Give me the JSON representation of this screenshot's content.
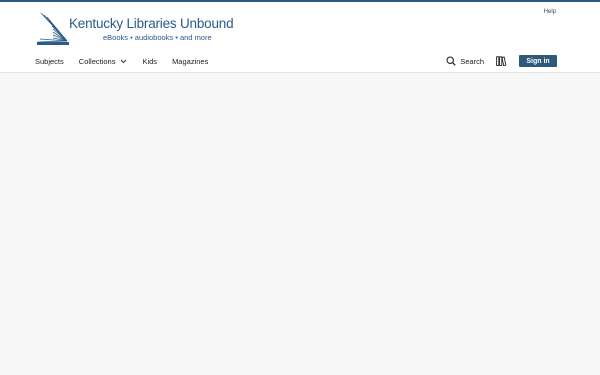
{
  "header": {
    "help_label": "Help",
    "logo": {
      "title": "Kentucky Libraries Unbound",
      "subtitle": "eBooks • audiobooks • and more"
    }
  },
  "nav": {
    "items": [
      {
        "label": "Subjects"
      },
      {
        "label": "Collections"
      },
      {
        "label": "Kids"
      },
      {
        "label": "Magazines"
      }
    ]
  },
  "tools": {
    "search_label": "Search",
    "signin_label": "Sign in"
  },
  "icons": [
    "book-logo-icon",
    "chevron-down-icon",
    "search-icon",
    "bookshelf-icon"
  ],
  "colors": {
    "brand": "#2c5a7a",
    "logo_text": "#2c5a8a",
    "page_background": "#f7f7f7"
  }
}
